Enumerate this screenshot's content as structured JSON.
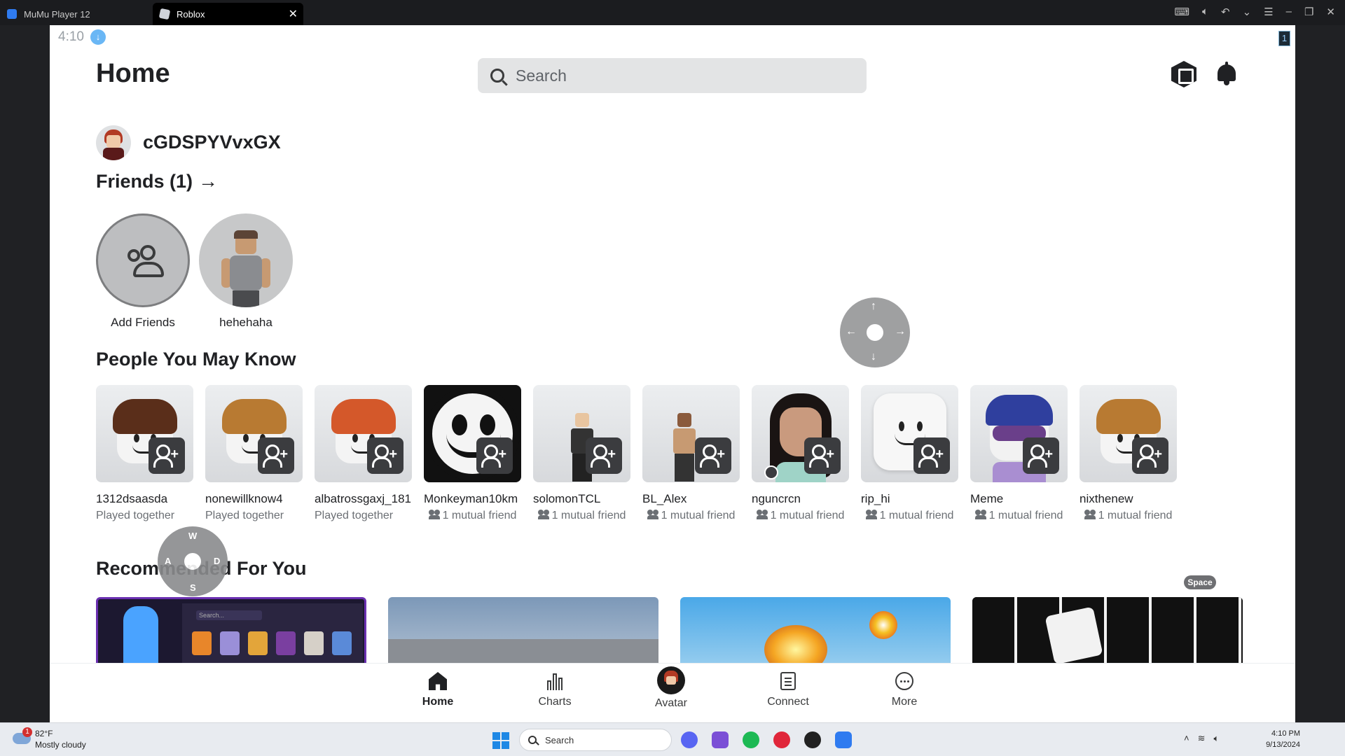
{
  "titlebar": {
    "tabs": [
      {
        "label": "MuMu Player 12"
      },
      {
        "label": "Roblox"
      }
    ],
    "controls": [
      "keyboard-icon",
      "volume-icon",
      "undo-icon",
      "chevron-down-icon",
      "menu-icon",
      "minimize-icon",
      "restore-icon",
      "close-icon"
    ]
  },
  "status": {
    "time": "4:10",
    "badge": "1"
  },
  "header": {
    "title": "Home",
    "search_placeholder": "Search"
  },
  "profile": {
    "username": "cGDSPYVvxGX"
  },
  "friends": {
    "title": "Friends (1)",
    "items": [
      {
        "name": "Add Friends"
      },
      {
        "name": "hehehaha"
      }
    ]
  },
  "people": {
    "title": "People You May Know",
    "items": [
      {
        "name": "1312dsaasda",
        "sub": "Played together"
      },
      {
        "name": "nonewillknow4",
        "sub": "Played together"
      },
      {
        "name": "albatrossgaxj_181",
        "sub": "Played together"
      },
      {
        "name": "Monkeyman10km",
        "sub": "1 mutual friend"
      },
      {
        "name": "solomonTCL",
        "sub": "1 mutual friend"
      },
      {
        "name": "BL_Alex",
        "sub": "1 mutual friend"
      },
      {
        "name": "nguncrcn",
        "sub": "1 mutual friend"
      },
      {
        "name": "rip_hi",
        "sub": "1 mutual friend"
      },
      {
        "name": "Meme",
        "sub": "1 mutual friend"
      },
      {
        "name": "nixthenew",
        "sub": "1 mutual friend"
      }
    ]
  },
  "recommended": {
    "title": "Recommended For You",
    "card1_search": "Search..."
  },
  "overlay": {
    "wasd": {
      "w": "W",
      "a": "A",
      "s": "S",
      "d": "D"
    },
    "space": "Space"
  },
  "bottom_nav": [
    {
      "label": "Home",
      "active": true
    },
    {
      "label": "Charts"
    },
    {
      "label": "Avatar"
    },
    {
      "label": "Connect"
    },
    {
      "label": "More"
    }
  ],
  "taskbar": {
    "weather_temp": "82°F",
    "weather_desc": "Mostly cloudy",
    "weather_badge": "1",
    "search_placeholder": "Search",
    "time": "4:10 PM",
    "date": "9/13/2024"
  }
}
